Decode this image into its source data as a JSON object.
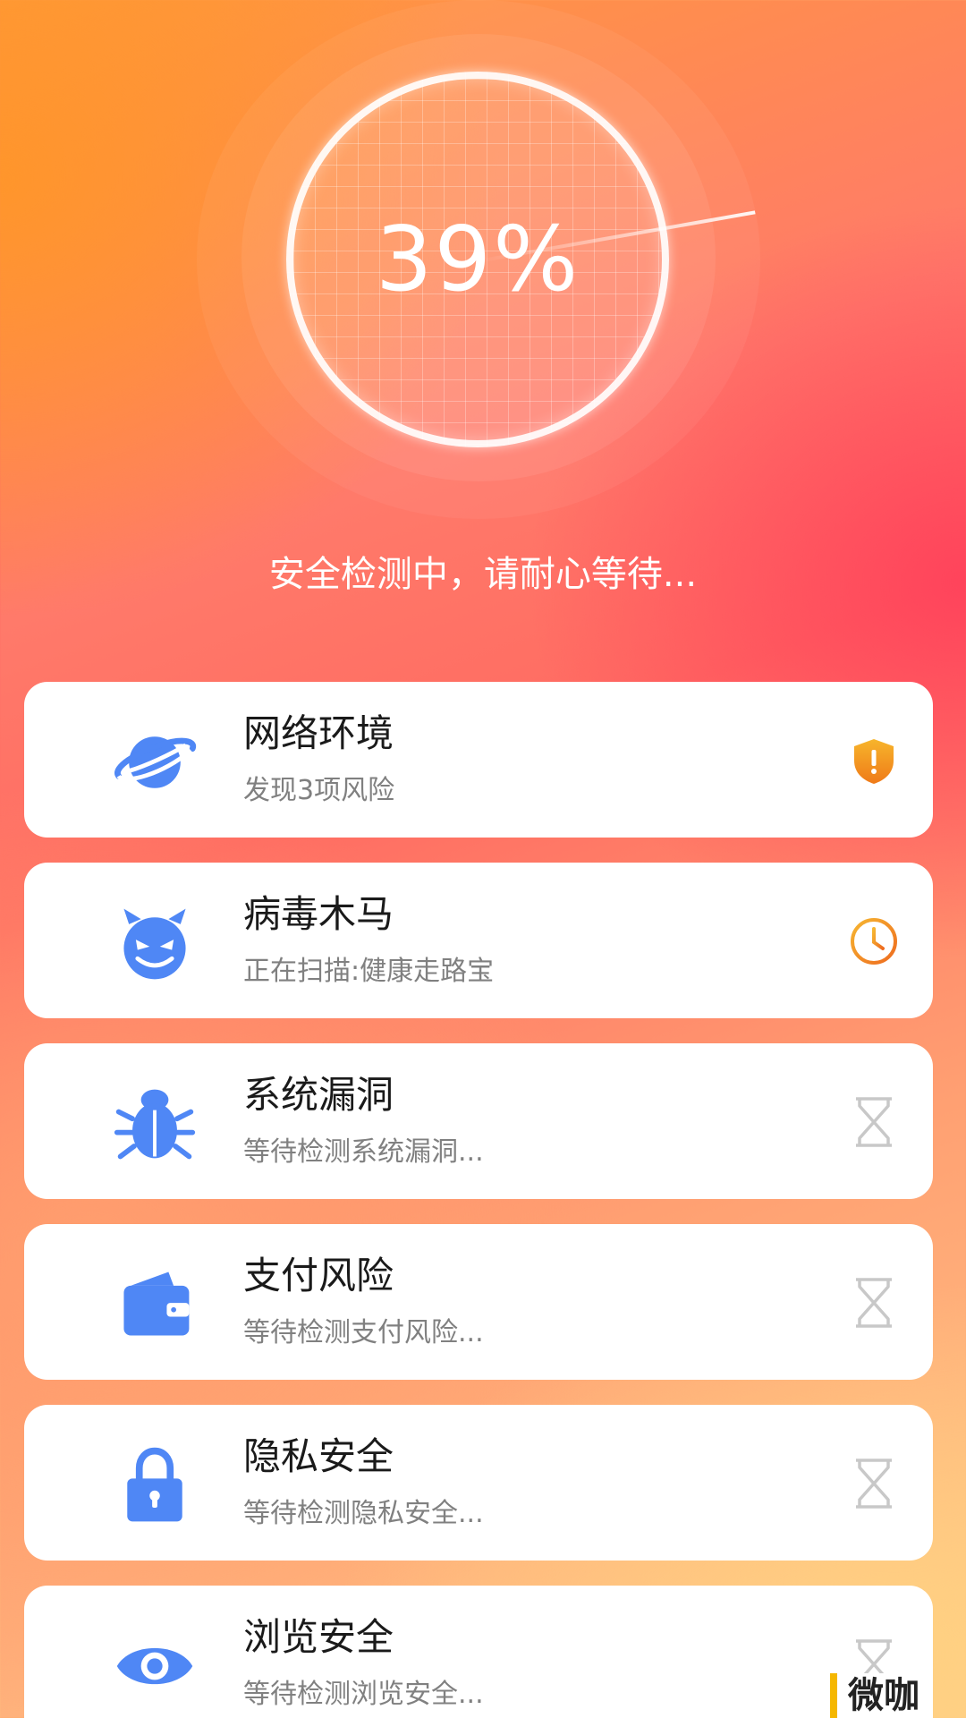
{
  "progress": {
    "percent_text": "39%",
    "value": 0.39,
    "status_text": "安全检测中，请耐心等待..."
  },
  "colors": {
    "icon_blue": "#4f87f5",
    "warning_orange": "#f5a020",
    "pending_gray": "#c8c8c8"
  },
  "items": [
    {
      "title": "网络环境",
      "subtitle": "发现3项风险",
      "icon": "planet-icon",
      "state": "warning-shield-icon"
    },
    {
      "title": "病毒木马",
      "subtitle": "正在扫描:健康走路宝",
      "icon": "devil-face-icon",
      "state": "clock-icon"
    },
    {
      "title": "系统漏洞",
      "subtitle": "等待检测系统漏洞...",
      "icon": "bug-icon",
      "state": "hourglass-icon"
    },
    {
      "title": "支付风险",
      "subtitle": "等待检测支付风险...",
      "icon": "wallet-icon",
      "state": "hourglass-icon"
    },
    {
      "title": "隐私安全",
      "subtitle": "等待检测隐私安全...",
      "icon": "lock-icon",
      "state": "hourglass-icon"
    },
    {
      "title": "浏览安全",
      "subtitle": "等待检测浏览安全...",
      "icon": "eye-icon",
      "state": "hourglass-icon"
    }
  ],
  "watermark": "微咖"
}
